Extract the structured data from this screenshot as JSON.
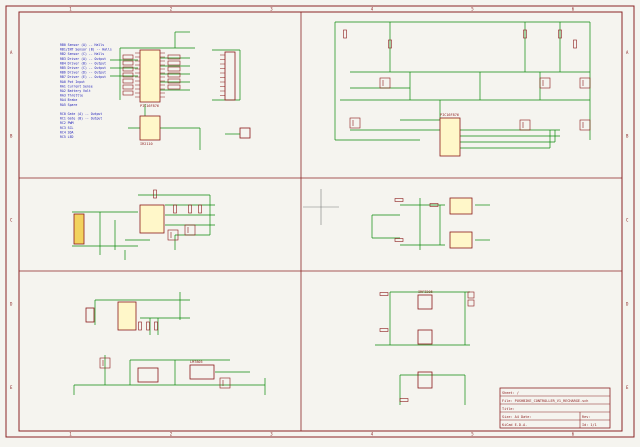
{
  "sheet": {
    "title_block": {
      "line1": "Sheet: /",
      "line2": "File: PUSHBIKE_CONTROLLER_V1_RECHARGE.sch",
      "line3": "Title:",
      "line4": "Size: A4   Date:",
      "line5": "KiCad E.D.A.",
      "rev": "Rev:",
      "id": "Id: 1/1"
    },
    "border_rows": [
      "A",
      "B",
      "C",
      "D",
      "E"
    ],
    "border_cols": [
      "1",
      "2",
      "3",
      "4",
      "5",
      "6"
    ]
  },
  "notes": {
    "lines": [
      "RB0 Sensor (A) -- Halls",
      "RB1/INT Sensor (B) -- Halls",
      "RB2 Sensor (C) -- Halls",
      "RB3 Driver (A) -- Output",
      "RB4 Driver (B) -- Output",
      "RB5 Driver (C) -- Output",
      "RB6 Driver (D) -- Output",
      "RB7 Driver (E) -- Output",
      "RA0 Pot Input",
      "RA1 Current Sense",
      "RA2 Battery Volt",
      "RA3 Throttle",
      "RA4 Brake",
      "RA5 Spare",
      "",
      "RC0 Gate (A) -- Output",
      "RC1 Gate (B) -- Output",
      "RC2 PWM",
      "RC3 SCL",
      "RC4 SDA",
      "RC5 LED"
    ]
  },
  "parts": {
    "mcu": "PIC16F876",
    "driver": "IR2110",
    "conn": "CONN_1",
    "bridge": "IRF3205",
    "reg": "LM7805",
    "cap": "C",
    "res": "R"
  },
  "colors": {
    "background": "#f5f4ef",
    "border": "#8b2424",
    "wire": "#0b8a0b",
    "part": "#8b1a1a",
    "text": "#1a1ab8",
    "cursor": "#7a7a7a"
  }
}
